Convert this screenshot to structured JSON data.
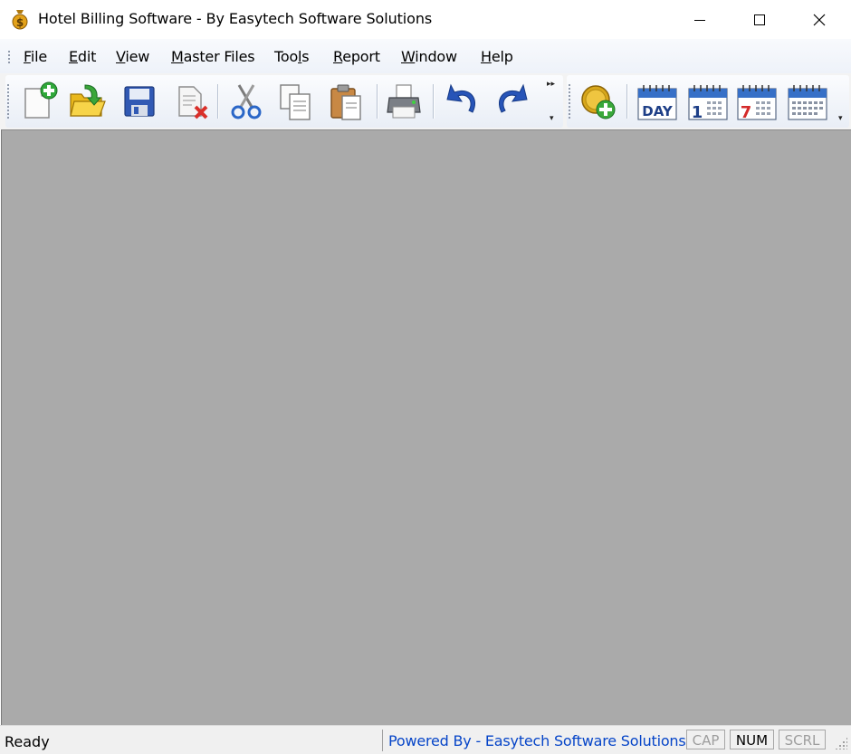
{
  "window": {
    "title": "Hotel Billing Software - By Easytech Software Solutions",
    "app_icon": "dollar-bag-icon",
    "controls": [
      "minimize-icon",
      "maximize-icon",
      "close-icon"
    ]
  },
  "menu": {
    "items": [
      {
        "label": "File",
        "underline_char": "F",
        "rest": "ile"
      },
      {
        "label": "Edit",
        "underline_char": "E",
        "rest": "dit"
      },
      {
        "label": "View",
        "underline_char": "V",
        "rest": "iew"
      },
      {
        "label": "Master Files",
        "underline_char": "M",
        "rest": "aster Files"
      },
      {
        "label": "Tools",
        "pre": "Too",
        "underline_char": "l",
        "rest": "s"
      },
      {
        "label": "Report",
        "underline_char": "R",
        "rest": "eport"
      },
      {
        "label": "Window",
        "underline_char": "W",
        "rest": "indow"
      },
      {
        "label": "Help",
        "underline_char": "H",
        "rest": "elp"
      }
    ]
  },
  "toolbar": {
    "standard": [
      "new-document-icon",
      "open-folder-icon",
      "save-icon",
      "delete-document-icon",
      "cut-icon",
      "copy-icon",
      "paste-icon",
      "print-icon",
      "undo-icon",
      "redo-icon"
    ],
    "billing": [
      "add-bill-icon",
      "day-report-icon",
      "calendar-1-icon",
      "calendar-7-icon",
      "calendar-month-icon"
    ],
    "calendar_labels": {
      "day": "DAY",
      "one": "1",
      "seven": "7"
    }
  },
  "statusbar": {
    "ready": "Ready",
    "powered_by": "Powered By - Easytech Software Solutions",
    "cap": "CAP",
    "num": "NUM",
    "scrl": "SCRL"
  },
  "colors": {
    "client_bg": "#aaaaaa",
    "powered_by": "#0645c8",
    "toolbar_bg": "#eef2f9"
  }
}
